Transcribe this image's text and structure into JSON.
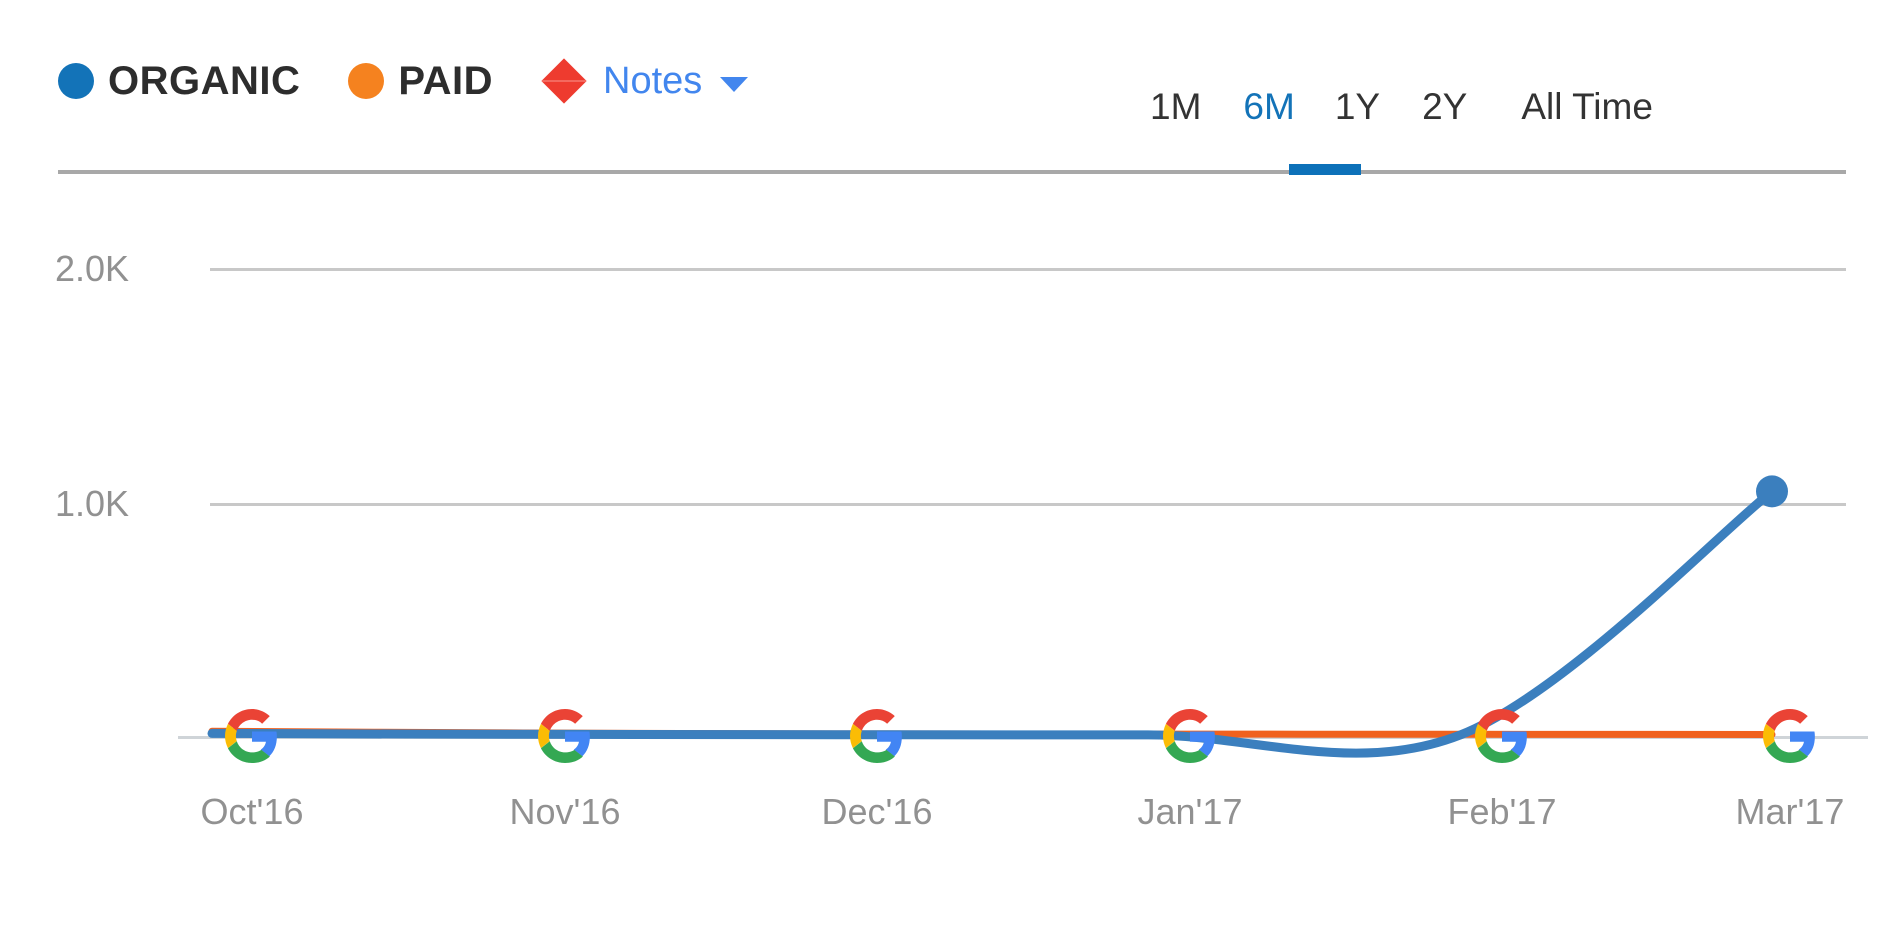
{
  "legend": {
    "series": [
      {
        "label": "ORGANIC",
        "color": "#1373b8",
        "marker": "circle"
      },
      {
        "label": "PAID",
        "color": "#f5821f",
        "marker": "circle"
      }
    ],
    "notes": {
      "label": "Notes",
      "marker": "diamond",
      "marker_color": "#ee3b2f",
      "text_color": "#4286ee",
      "caret": "chevron-down-icon"
    }
  },
  "ranges": {
    "options": [
      "1M",
      "6M",
      "1Y",
      "2Y",
      "All Time"
    ],
    "selected": "6M",
    "active_color": "#1373b8",
    "inactive_color": "#333333"
  },
  "chart_data": {
    "type": "line",
    "title": "",
    "xlabel": "",
    "ylabel": "",
    "x": [
      "Oct'16",
      "Nov'16",
      "Dec'16",
      "Jan'17",
      "Feb'17",
      "Mar'17"
    ],
    "ylim": [
      0,
      2200
    ],
    "yticks": [
      1000,
      2000
    ],
    "ytick_labels": [
      "1.0K",
      "2.0K"
    ],
    "grid": "horizontal",
    "legend_position": "top-left",
    "series": [
      {
        "name": "ORGANIC",
        "color": "#3b7fbe",
        "values": [
          12,
          8,
          6,
          5,
          4,
          1150
        ],
        "end_point_marker": true
      },
      {
        "name": "PAID",
        "color": "#f0611e",
        "values": [
          22,
          14,
          10,
          9,
          8,
          7
        ]
      }
    ],
    "annotations": [
      {
        "type": "google-update-marker",
        "x": "Oct'16",
        "y": 0,
        "icon": "google-g-icon"
      },
      {
        "type": "google-update-marker",
        "x": "Nov'16",
        "y": 0,
        "icon": "google-g-icon"
      },
      {
        "type": "google-update-marker",
        "x": "Dec'16",
        "y": 0,
        "icon": "google-g-icon"
      },
      {
        "type": "google-update-marker",
        "x": "Jan'17",
        "y": 0,
        "icon": "google-g-icon"
      },
      {
        "type": "google-update-marker",
        "x": "Feb'17",
        "y": 0,
        "icon": "google-g-icon"
      },
      {
        "type": "google-update-marker",
        "x": "Mar'17",
        "y": 0,
        "icon": "google-g-icon"
      }
    ]
  }
}
